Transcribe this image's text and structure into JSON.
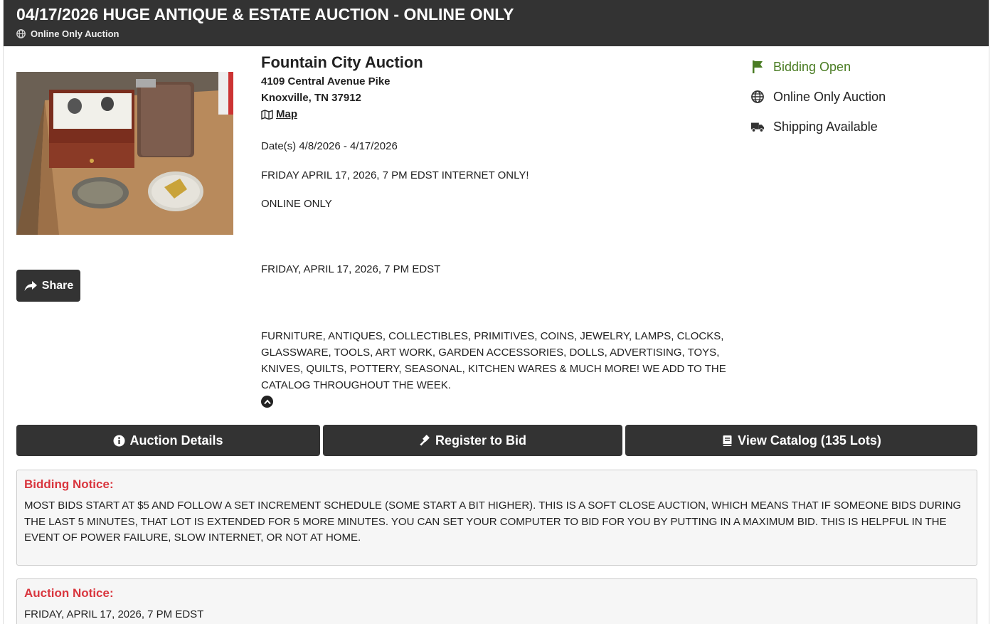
{
  "header": {
    "title": "04/17/2026 HUGE ANTIQUE & ESTATE AUCTION - ONLINE ONLY",
    "subtitle": "Online Only Auction"
  },
  "auctioneer": {
    "name": "Fountain City Auction",
    "address_line1": "4109 Central Avenue Pike",
    "address_line2": "Knoxville, TN 37912",
    "map_label": "Map"
  },
  "share_label": "Share",
  "details": {
    "dates": "Date(s) 4/8/2026 - 4/17/2026",
    "line1": "FRIDAY APRIL 17, 2026, 7 PM EDST INTERNET ONLY!",
    "line2": "ONLINE ONLY",
    "line3": "FRIDAY, APRIL 17, 2026, 7 PM EDST",
    "line4": "FURNITURE, ANTIQUES, COLLECTIBLES, PRIMITIVES, COINS, JEWELRY, LAMPS, CLOCKS, GLASSWARE, TOOLS, ART WORK, GARDEN ACCESSORIES, DOLLS, ADVERTISING, TOYS, KNIVES, QUILTS, POTTERY, SEASONAL, KITCHEN WARES & MUCH MORE! WE ADD TO THE CATALOG THROUGHOUT THE WEEK."
  },
  "status": {
    "bidding": "Bidding Open",
    "type": "Online Only Auction",
    "shipping": "Shipping Available"
  },
  "buttons": {
    "details": "Auction Details",
    "register": "Register to Bid",
    "catalog": "View Catalog (135 Lots)"
  },
  "notices": [
    {
      "title": "Bidding Notice:",
      "body": "MOST BIDS START AT $5 AND FOLLOW A SET INCREMENT SCHEDULE (SOME START A BIT HIGHER). THIS IS A SOFT CLOSE AUCTION, WHICH MEANS THAT IF SOMEONE BIDS DURING THE LAST 5 MINUTES, THAT LOT IS EXTENDED FOR 5 MORE MINUTES. YOU CAN SET YOUR COMPUTER TO BID FOR YOU BY PUTTING IN A MAXIMUM BID. THIS IS HELPFUL IN THE EVENT OF POWER FAILURE, SLOW INTERNET, OR NOT AT HOME."
    },
    {
      "title": "Auction Notice:",
      "body": "FRIDAY, APRIL 17, 2026, 7 PM EDST"
    }
  ],
  "colors": {
    "header_bg": "#333333",
    "status_green": "#4a7c23",
    "notice_red": "#d9363e"
  }
}
